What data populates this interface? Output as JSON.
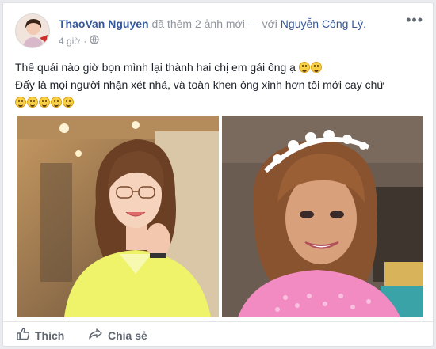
{
  "post": {
    "author": "ThaoVan Nguyen",
    "action_text": "đã thêm 2 ảnh mới — với",
    "tagged": "Nguyễn Công Lý.",
    "time": "4 giờ",
    "audience_icon": "globe-icon",
    "more_icon": "more-options-icon",
    "line1": "Thế quái nào giờ bọn mình lại thành hai chị em gái ông ạ",
    "line2": "Đấy là mọi người nhận xét nhá, và toàn khen ông xinh hơn tôi mới cay chứ"
  },
  "photos": [
    {
      "name": "photo-woman-yellow"
    },
    {
      "name": "photo-man-tiara-pink"
    }
  ],
  "actions": {
    "like_label": "Thích",
    "like_icon": "thumbs-up-icon",
    "share_label": "Chia sẻ",
    "share_icon": "share-arrow-icon"
  },
  "colors": {
    "link": "#365899",
    "muted": "#90949c",
    "text": "#1d2129",
    "background": "#e9ebee"
  }
}
